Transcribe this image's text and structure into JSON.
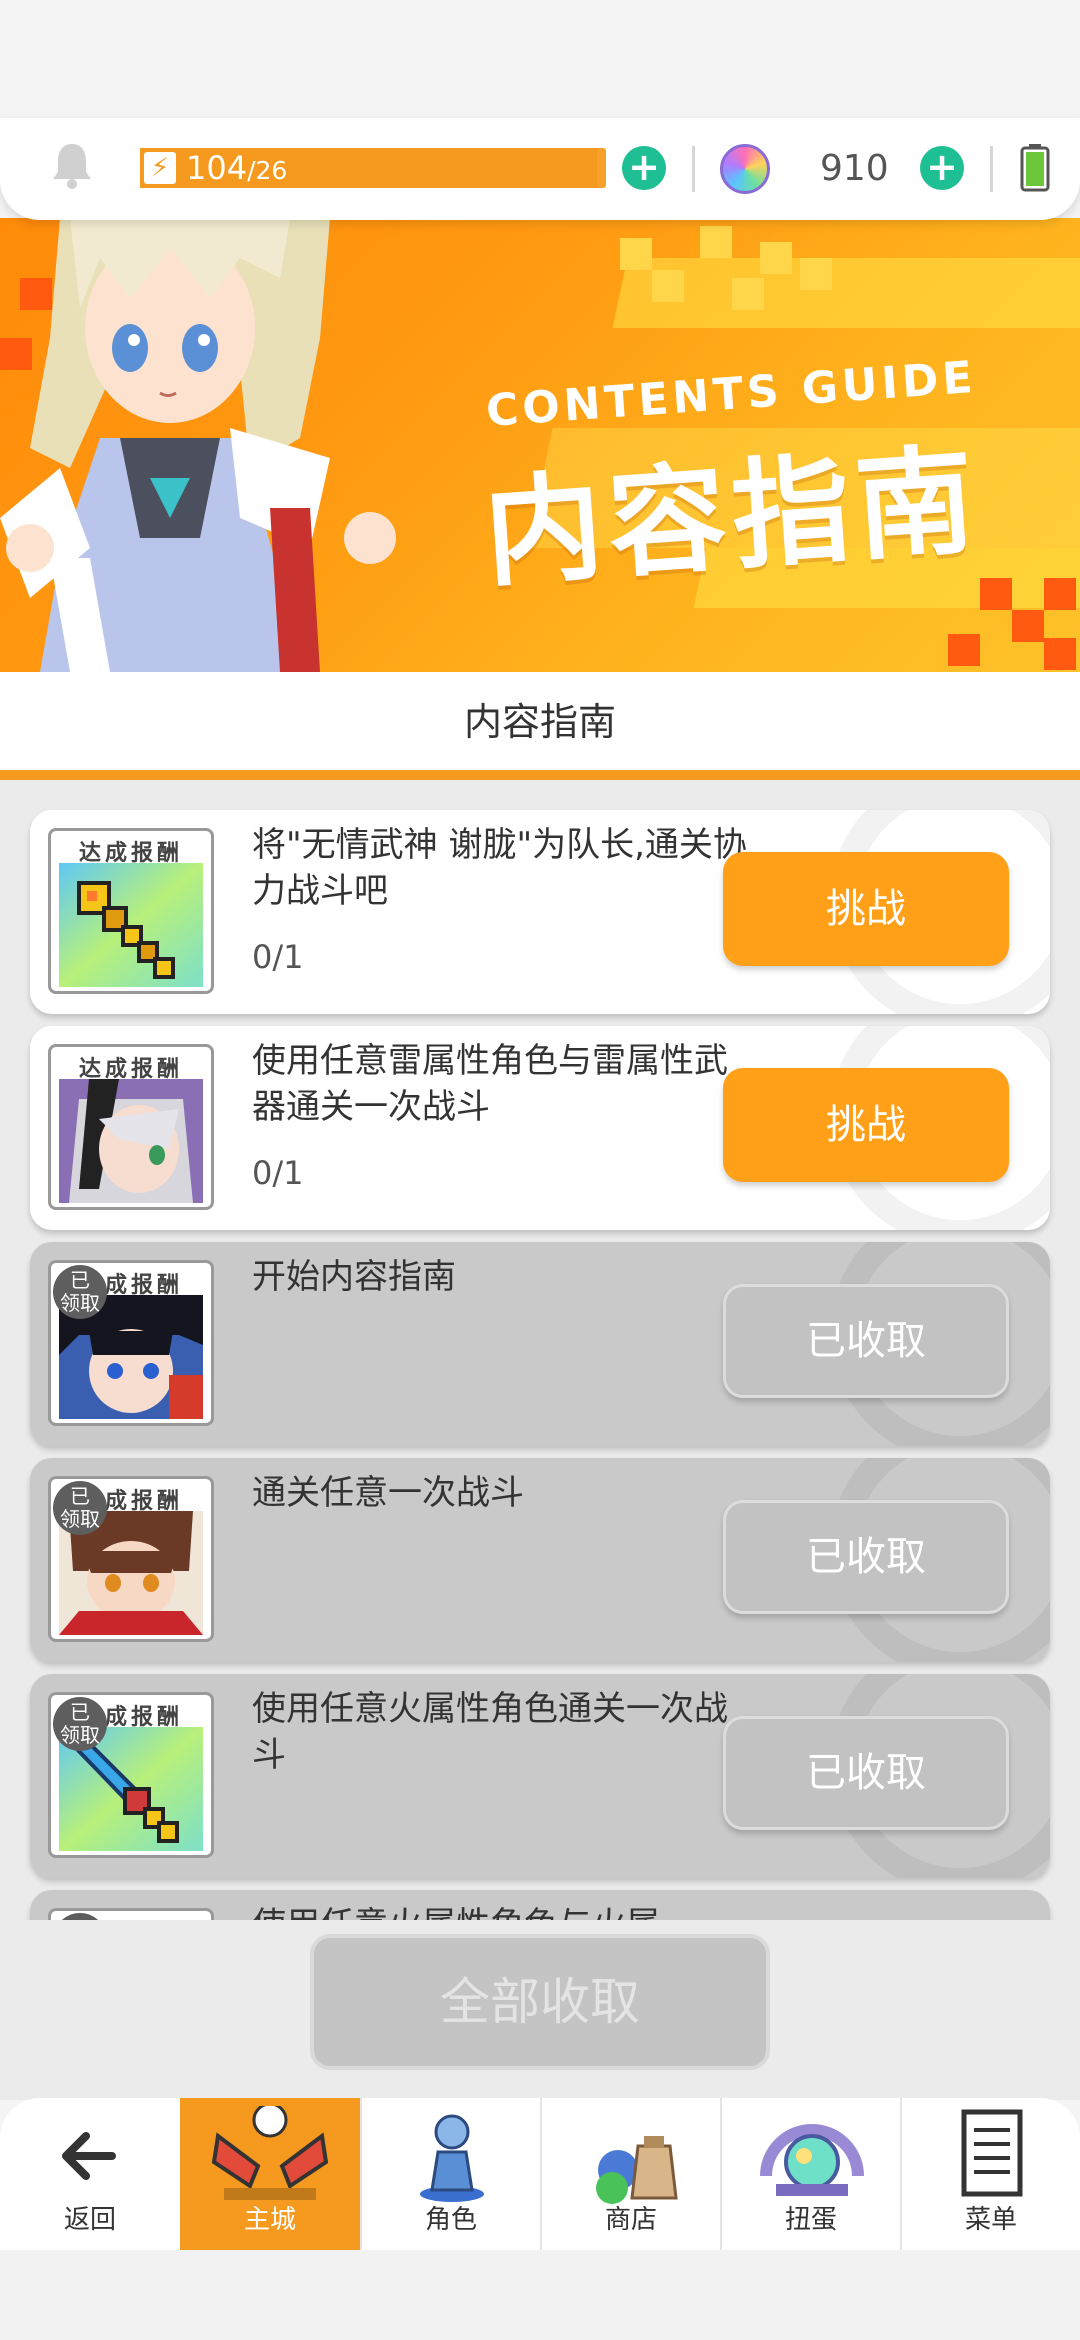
{
  "status": {
    "energy_current": "104",
    "energy_max": "/26",
    "energy_fill_fraction": 0.98,
    "gem_count": "910"
  },
  "banner": {
    "title_en": "CONTENTS GUIDE",
    "title_cn": "内容指南"
  },
  "section": {
    "title": "内容指南"
  },
  "reward_label": "达成报酬",
  "claimed_label_1": "已",
  "claimed_label_2": "领取",
  "tasks": [
    {
      "desc": "将\"无情武神 谢胧\"为队长,通关协力战斗吧",
      "progress": "0/1",
      "button": "挑战"
    },
    {
      "desc": "使用任意雷属性角色与雷属性武器通关一次战斗",
      "progress": "0/1",
      "button": "挑战"
    },
    {
      "desc": "开始内容指南",
      "progress": "",
      "button": "已收取"
    },
    {
      "desc": "通关任意一次战斗",
      "progress": "",
      "button": "已收取"
    },
    {
      "desc": "使用任意火属性角色通关一次战斗",
      "progress": "",
      "button": "已收取"
    },
    {
      "desc": "使用任意火属性角色与火属",
      "progress": "",
      "button": ""
    }
  ],
  "collect_all": "全部收取",
  "nav": {
    "back": "返回",
    "city": "主城",
    "character": "角色",
    "shop": "商店",
    "gacha": "扭蛋",
    "menu": "菜单"
  }
}
